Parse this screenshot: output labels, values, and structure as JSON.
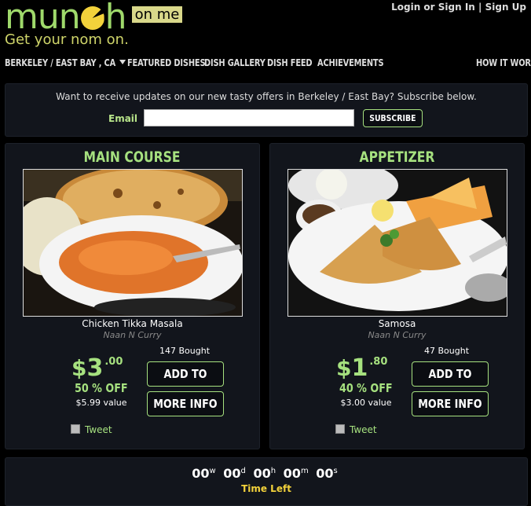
{
  "header": {
    "logo_word": "munch",
    "logo_pre": "mun",
    "logo_post": "h",
    "logo_badge": "on me",
    "tagline": "Get your nom on.",
    "login_label": "Login or Sign In",
    "separator": "|",
    "signup_label": "Sign Up"
  },
  "nav": {
    "location": "BERKELEY / EAST BAY , CA",
    "items": [
      "FEATURED DISHES",
      "DISH GALLERY",
      "DISH FEED",
      "ACHIEVEMENTS"
    ],
    "how_it_works": "HOW IT WORKS"
  },
  "subscribe": {
    "message": "Want to receive updates on our new tasty offers in Berkeley / East Bay? Subscribe below.",
    "email_label": "Email",
    "email_value": "",
    "button_label": "SUBSCRIBE"
  },
  "deals": [
    {
      "category": "MAIN COURSE",
      "dish": "Chicken Tikka Masala",
      "restaurant": "Naan N Curry",
      "bought": "147 Bought",
      "currency": "$",
      "price_dollars": "3",
      "price_cents": ".00",
      "discount": "50 % OFF",
      "value": "$5.99 value",
      "add_label": "ADD TO CART",
      "info_label": "MORE INFO",
      "tweet_label": "Tweet"
    },
    {
      "category": "APPETIZER",
      "dish": "Samosa",
      "restaurant": "Naan N Curry",
      "bought": "47 Bought",
      "currency": "$",
      "price_dollars": "1",
      "price_cents": ".80",
      "discount": "40 % OFF",
      "value": "$3.00 value",
      "add_label": "ADD TO CART",
      "info_label": "MORE INFO",
      "tweet_label": "Tweet"
    }
  ],
  "timer": {
    "weeks": "00",
    "weeks_unit": "w",
    "days": "00",
    "days_unit": "d",
    "hours": "00",
    "hours_unit": "h",
    "minutes": "00",
    "minutes_unit": "m",
    "seconds": "00",
    "seconds_unit": "s",
    "label": "Time Left"
  },
  "colors": {
    "accent_green": "#a6e17f",
    "logo_green": "#9fd96b",
    "logo_yellow": "#f3d23b",
    "panel_bg": "#12151c"
  }
}
